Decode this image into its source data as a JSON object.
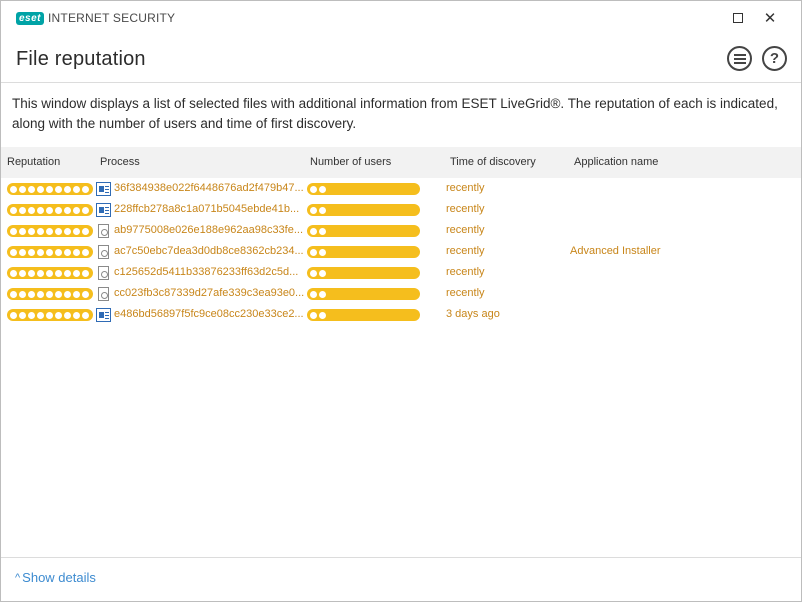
{
  "app": {
    "brand": "eset",
    "product": "INTERNET SECURITY"
  },
  "window_controls": {
    "maximize_icon": "maximize-icon",
    "close_icon": "close-icon",
    "close_glyph": "✕"
  },
  "header": {
    "title": "File reputation",
    "help_glyph": "?"
  },
  "description": "This window displays a list of selected files with additional information from ESET LiveGrid®. The reputation of each is indicated, along with the number of users and time of first discovery.",
  "table": {
    "columns": [
      "Reputation",
      "Process",
      "Number of users",
      "Time of discovery",
      "Application name"
    ],
    "rows": [
      {
        "reputation": 9,
        "users": 2,
        "icon": "app",
        "process": "36f384938e022f6448676ad2f479b47...",
        "time": "recently",
        "app_name": ""
      },
      {
        "reputation": 9,
        "users": 2,
        "icon": "app",
        "process": "228ffcb278a8c1a071b5045ebde41b...",
        "time": "recently",
        "app_name": ""
      },
      {
        "reputation": 9,
        "users": 2,
        "icon": "file",
        "process": "ab9775008e026e188e962aa98c33fe...",
        "time": "recently",
        "app_name": ""
      },
      {
        "reputation": 9,
        "users": 2,
        "icon": "file",
        "process": "ac7c50ebc7dea3d0db8ce8362cb234...",
        "time": "recently",
        "app_name": "Advanced Installer"
      },
      {
        "reputation": 9,
        "users": 2,
        "icon": "file",
        "process": "c125652d5411b33876233ff63d2c5d...",
        "time": "recently",
        "app_name": ""
      },
      {
        "reputation": 9,
        "users": 2,
        "icon": "file",
        "process": "cc023fb3c87339d27afe339c3ea93e0...",
        "time": "recently",
        "app_name": ""
      },
      {
        "reputation": 9,
        "users": 2,
        "icon": "app",
        "process": "e486bd56897f5fc9ce08cc230e33ce2...",
        "time": "3 days ago",
        "app_name": ""
      }
    ]
  },
  "footer": {
    "show_details": "Show details",
    "chevron_glyph": "^"
  },
  "colors": {
    "accent": "#3d8bd0",
    "bar": "#f5be1d",
    "row_text": "#c8861a",
    "brand": "#00a3a6"
  }
}
